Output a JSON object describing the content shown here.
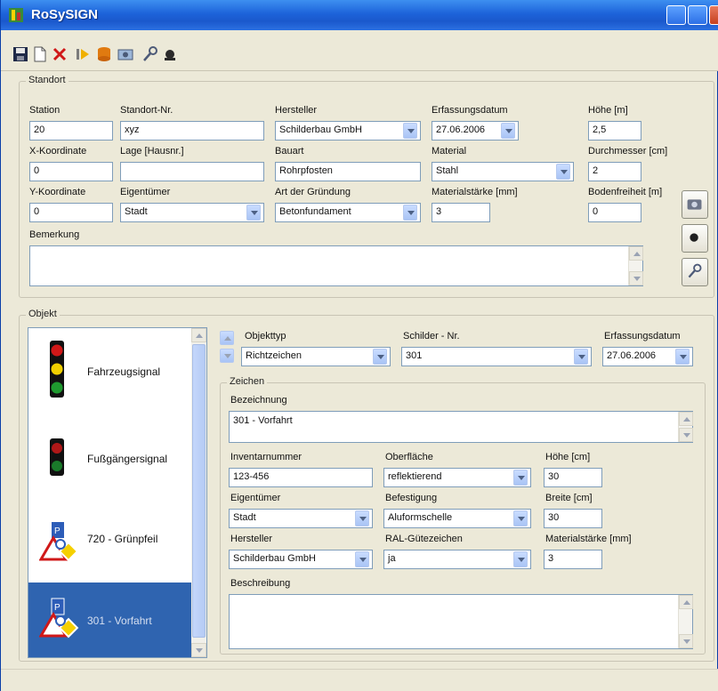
{
  "window": {
    "title": "RoSySIGN"
  },
  "colors": {
    "titlebar": "#1d63da",
    "selected": "#2f64b0",
    "field_border": "#7f9db9"
  },
  "toolbar": {
    "icons": [
      "save-icon",
      "new-icon",
      "delete-icon",
      "forward-icon",
      "database-icon",
      "image-icon",
      "key-icon",
      "stamp-icon"
    ]
  },
  "standort": {
    "legend": "Standort",
    "station": {
      "label": "Station",
      "value": "20"
    },
    "standort_nr": {
      "label": "Standort-Nr.",
      "value": "xyz"
    },
    "hersteller": {
      "label": "Hersteller",
      "value": "Schilderbau GmbH"
    },
    "erfassungsdatum": {
      "label": "Erfassungsdatum",
      "value": "27.06.2006"
    },
    "hoehe": {
      "label": "Höhe [m]",
      "value": "2,5"
    },
    "x_koordinate": {
      "label": "X-Koordinate",
      "value": "0"
    },
    "lage": {
      "label": "Lage [Hausnr.]",
      "value": ""
    },
    "bauart": {
      "label": "Bauart",
      "value": "Rohrpfosten"
    },
    "material": {
      "label": "Material",
      "value": "Stahl"
    },
    "durchmesser": {
      "label": "Durchmesser [cm]",
      "value": "2"
    },
    "y_koordinate": {
      "label": "Y-Koordinate",
      "value": "0"
    },
    "eigentuemer": {
      "label": "Eigentümer",
      "value": "Stadt"
    },
    "gruendung": {
      "label": "Art der Gründung",
      "value": "Betonfundament"
    },
    "materialstaerke": {
      "label": "Materialstärke [mm]",
      "value": "3"
    },
    "bodenfreiheit": {
      "label": "Bodenfreiheit [m]",
      "value": "0"
    },
    "bemerkung": {
      "label": "Bemerkung",
      "value": ""
    }
  },
  "objekt": {
    "legend": "Objekt",
    "list": [
      {
        "label": "Fahrzeugsignal",
        "icon": "traffic-light-icon"
      },
      {
        "label": "Fußgängersignal",
        "icon": "pedestrian-light-icon"
      },
      {
        "label": "720 - Grünpfeil",
        "icon": "sign-group-icon"
      },
      {
        "label": "301 - Vorfahrt",
        "icon": "sign-group-icon"
      }
    ],
    "objekttyp": {
      "label": "Objekttyp",
      "value": "Richtzeichen"
    },
    "schilder_nr": {
      "label": "Schilder - Nr.",
      "value": "301"
    },
    "erfassungsdatum": {
      "label": "Erfassungsdatum",
      "value": "27.06.2006"
    },
    "zeichen": {
      "legend": "Zeichen",
      "bezeichnung": {
        "label": "Bezeichnung",
        "value": "301 - Vorfahrt"
      },
      "inventarnummer": {
        "label": "Inventarnummer",
        "value": "123-456"
      },
      "oberflaeche": {
        "label": "Oberfläche",
        "value": "reflektierend"
      },
      "hoehe": {
        "label": "Höhe [cm]",
        "value": "30"
      },
      "eigentuemer": {
        "label": "Eigentümer",
        "value": "Stadt"
      },
      "befestigung": {
        "label": "Befestigung",
        "value": "Aluformschelle"
      },
      "breite": {
        "label": "Breite [cm]",
        "value": "30"
      },
      "hersteller": {
        "label": "Hersteller",
        "value": "Schilderbau GmbH"
      },
      "ral": {
        "label": "RAL-Gütezeichen",
        "value": "ja"
      },
      "materialstaerke": {
        "label": "Materialstärke [mm]",
        "value": "3"
      },
      "beschreibung": {
        "label": "Beschreibung",
        "value": ""
      }
    }
  }
}
